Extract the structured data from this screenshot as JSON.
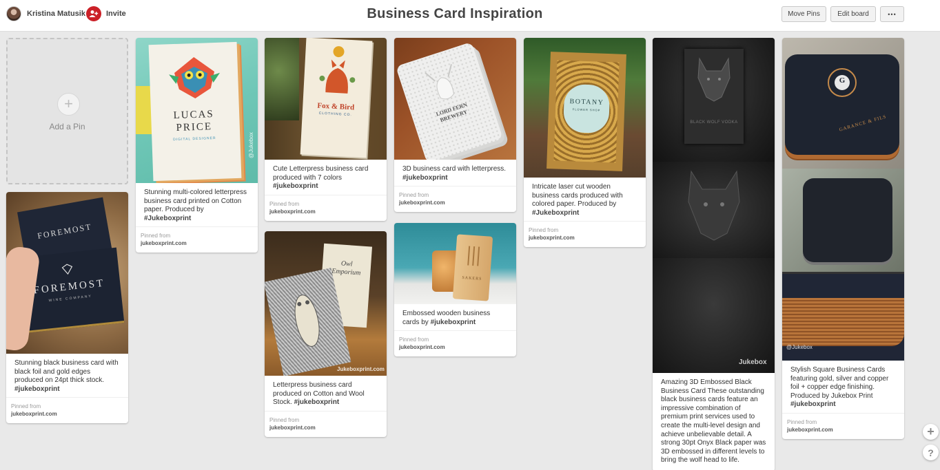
{
  "header": {
    "user_name": "Kristina Matusik",
    "invite_label": "Invite",
    "board_title": "Business Card Inspiration",
    "move_pins_label": "Move Pins",
    "edit_board_label": "Edit board",
    "more_label": "•••"
  },
  "add_pin": {
    "label": "Add a Pin",
    "plus": "+"
  },
  "pins": [
    {
      "desc": "Stunning multi-colored letterpress business card printed on Cotton paper. Produced by",
      "tag": "#Jukeboxprint",
      "pinned_label": "Pinned from",
      "source": "jukeboxprint.com",
      "card_lines": [
        "LUCAS",
        "PRICE",
        "DIGITAL DESIGNER"
      ],
      "watermark": "@Jukebox"
    },
    {
      "desc": "Stunning black business card with black foil and gold edges produced on 24pt thick stock.",
      "tag": "#jukeboxprint",
      "pinned_label": "Pinned from",
      "source": "jukeboxprint.com",
      "card_lines": [
        "FOREMOST",
        "WINE COMPANY"
      ]
    },
    {
      "desc": "Cute Letterpress business card produced with 7 colors",
      "tag": "#jukeboxprint",
      "pinned_label": "Pinned from",
      "source": "jukeboxprint.com",
      "card_lines": [
        "Fox & Bird",
        "CLOTHING CO."
      ]
    },
    {
      "desc": "Letterpress business card produced on Cotton and Wool Stock.",
      "tag": "#jukeboxprint",
      "pinned_label": "Pinned from",
      "source": "jukeboxprint.com",
      "card_lines": [
        "Owl",
        "Emporium"
      ],
      "watermark": "Jukeboxprint.com"
    },
    {
      "desc": "3D business card with letterpress.",
      "tag": "#jukeboxprint",
      "pinned_label": "Pinned from",
      "source": "jukeboxprint.com",
      "card_lines": [
        "LORD FERN",
        "BREWERY"
      ]
    },
    {
      "desc": "Embossed wooden business cards by",
      "tag": "#jukeboxprint",
      "pinned_label": "Pinned from",
      "source": "jukeboxprint.com",
      "card_lines": [
        "SAKERS"
      ]
    },
    {
      "desc": "Intricate laser cut wooden business cards produced with colored paper. Produced by",
      "tag": "#Jukeboxprint",
      "pinned_label": "Pinned from",
      "source": "jukeboxprint.com",
      "card_lines": [
        "BOTANY",
        "FLOWER SHOP"
      ]
    },
    {
      "desc": "Amazing 3D Embossed Black Business Card These outstanding black business cards feature an impressive combination of premium print services used to create the multi-level design and achieve unbelievable detail. A strong 30pt Onyx Black paper was 3D embossed in different levels to bring the wolf head to life.",
      "tag": "",
      "card_lines": [
        "BLACK WOLF VODKA"
      ],
      "watermark": "Jukebox"
    },
    {
      "desc": "Stylish Square Business Cards featuring gold, silver and copper foil + copper edge finishing. Produced by Jukebox Print",
      "tag": "#jukeboxprint",
      "pinned_label": "Pinned from",
      "source": "jukeboxprint.com",
      "card_lines": [
        "G",
        "GARANCE & FILS"
      ],
      "watermark": "@Jukebox"
    }
  ],
  "fab": {
    "plus": "+",
    "help": "?"
  }
}
